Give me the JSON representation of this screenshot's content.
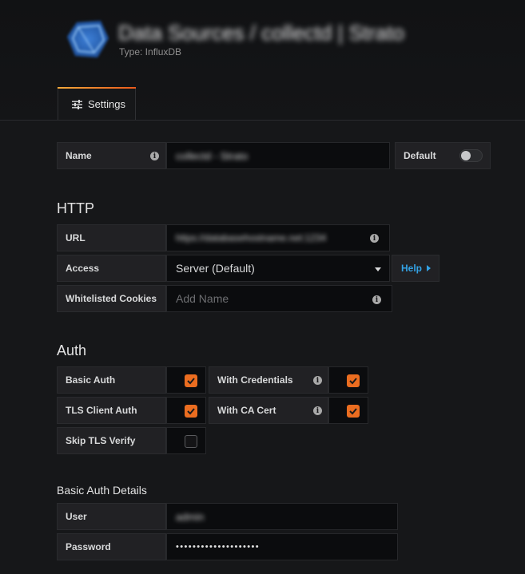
{
  "header": {
    "title": "Data Sources / collectd | Strato",
    "type_label": "Type: InfluxDB"
  },
  "tabs": [
    {
      "label": "Settings"
    }
  ],
  "name_row": {
    "label": "Name",
    "value": "collectd - Strato",
    "default_label": "Default",
    "default_enabled": false
  },
  "http": {
    "heading": "HTTP",
    "url_label": "URL",
    "url_value": "https://databasehostname.net:1234",
    "access_label": "Access",
    "access_value": "Server (Default)",
    "help_label": "Help",
    "cookies_label": "Whitelisted Cookies",
    "cookies_placeholder": "Add Name"
  },
  "auth": {
    "heading": "Auth",
    "basic_auth_label": "Basic Auth",
    "basic_auth_checked": true,
    "with_credentials_label": "With Credentials",
    "with_credentials_checked": true,
    "tls_client_auth_label": "TLS Client Auth",
    "tls_client_auth_checked": true,
    "with_ca_cert_label": "With CA Cert",
    "with_ca_cert_checked": true,
    "skip_tls_label": "Skip TLS Verify",
    "skip_tls_checked": false
  },
  "basic_auth_details": {
    "heading": "Basic Auth Details",
    "user_label": "User",
    "user_value": "admin",
    "password_label": "Password",
    "password_value": "••••••••••••••••••••"
  },
  "colors": {
    "accent": "#eb6d20",
    "link": "#33a2e5",
    "background": "#161719"
  }
}
